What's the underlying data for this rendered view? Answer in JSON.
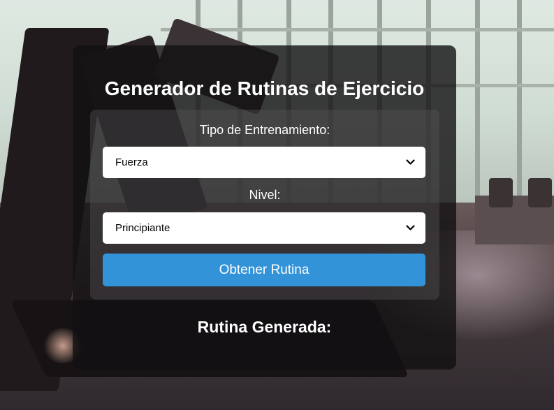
{
  "page": {
    "title": "Generador de Rutinas de Ejercicio",
    "accent_color": "#3393d8"
  },
  "form": {
    "training_type_label": "Tipo de Entrenamiento:",
    "training_type_value": "Fuerza",
    "level_label": "Nivel:",
    "level_value": "Principiante",
    "submit_label": "Obtener Rutina"
  },
  "result": {
    "heading": "Rutina Generada:"
  },
  "icons": {
    "select_arrow": "chevron-down-icon"
  }
}
